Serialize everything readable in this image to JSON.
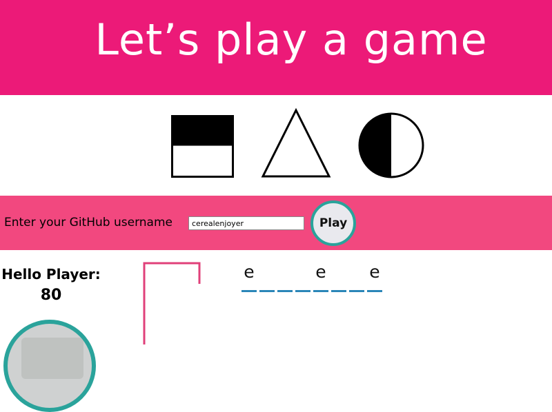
{
  "header": {
    "title": "Let’s play a game"
  },
  "form": {
    "label": "Enter your GitHub username",
    "username_value": "cerealenjoyer",
    "play_label": "Play"
  },
  "player": {
    "greeting": "Hello Player:",
    "score": "80"
  },
  "word": {
    "letters": [
      "e",
      "",
      "",
      "",
      "e",
      "",
      "",
      "e"
    ]
  },
  "colors": {
    "header_bg": "#ec1a78",
    "form_bg": "#f2487f",
    "accent_teal": "#2aa39b",
    "slot_line": "#2a86b8"
  }
}
